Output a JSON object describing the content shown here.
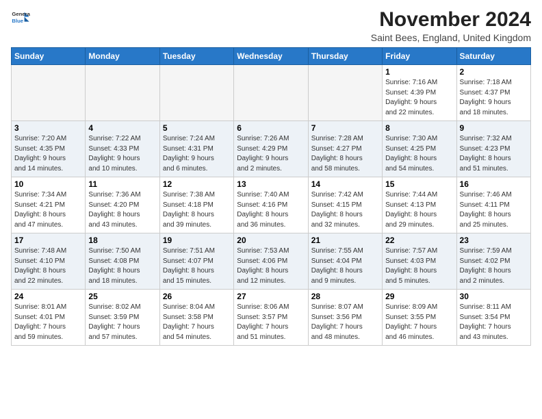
{
  "header": {
    "logo_line1": "General",
    "logo_line2": "Blue",
    "month": "November 2024",
    "location": "Saint Bees, England, United Kingdom"
  },
  "weekdays": [
    "Sunday",
    "Monday",
    "Tuesday",
    "Wednesday",
    "Thursday",
    "Friday",
    "Saturday"
  ],
  "weeks": [
    [
      {
        "day": "",
        "info": ""
      },
      {
        "day": "",
        "info": ""
      },
      {
        "day": "",
        "info": ""
      },
      {
        "day": "",
        "info": ""
      },
      {
        "day": "",
        "info": ""
      },
      {
        "day": "1",
        "info": "Sunrise: 7:16 AM\nSunset: 4:39 PM\nDaylight: 9 hours\nand 22 minutes."
      },
      {
        "day": "2",
        "info": "Sunrise: 7:18 AM\nSunset: 4:37 PM\nDaylight: 9 hours\nand 18 minutes."
      }
    ],
    [
      {
        "day": "3",
        "info": "Sunrise: 7:20 AM\nSunset: 4:35 PM\nDaylight: 9 hours\nand 14 minutes."
      },
      {
        "day": "4",
        "info": "Sunrise: 7:22 AM\nSunset: 4:33 PM\nDaylight: 9 hours\nand 10 minutes."
      },
      {
        "day": "5",
        "info": "Sunrise: 7:24 AM\nSunset: 4:31 PM\nDaylight: 9 hours\nand 6 minutes."
      },
      {
        "day": "6",
        "info": "Sunrise: 7:26 AM\nSunset: 4:29 PM\nDaylight: 9 hours\nand 2 minutes."
      },
      {
        "day": "7",
        "info": "Sunrise: 7:28 AM\nSunset: 4:27 PM\nDaylight: 8 hours\nand 58 minutes."
      },
      {
        "day": "8",
        "info": "Sunrise: 7:30 AM\nSunset: 4:25 PM\nDaylight: 8 hours\nand 54 minutes."
      },
      {
        "day": "9",
        "info": "Sunrise: 7:32 AM\nSunset: 4:23 PM\nDaylight: 8 hours\nand 51 minutes."
      }
    ],
    [
      {
        "day": "10",
        "info": "Sunrise: 7:34 AM\nSunset: 4:21 PM\nDaylight: 8 hours\nand 47 minutes."
      },
      {
        "day": "11",
        "info": "Sunrise: 7:36 AM\nSunset: 4:20 PM\nDaylight: 8 hours\nand 43 minutes."
      },
      {
        "day": "12",
        "info": "Sunrise: 7:38 AM\nSunset: 4:18 PM\nDaylight: 8 hours\nand 39 minutes."
      },
      {
        "day": "13",
        "info": "Sunrise: 7:40 AM\nSunset: 4:16 PM\nDaylight: 8 hours\nand 36 minutes."
      },
      {
        "day": "14",
        "info": "Sunrise: 7:42 AM\nSunset: 4:15 PM\nDaylight: 8 hours\nand 32 minutes."
      },
      {
        "day": "15",
        "info": "Sunrise: 7:44 AM\nSunset: 4:13 PM\nDaylight: 8 hours\nand 29 minutes."
      },
      {
        "day": "16",
        "info": "Sunrise: 7:46 AM\nSunset: 4:11 PM\nDaylight: 8 hours\nand 25 minutes."
      }
    ],
    [
      {
        "day": "17",
        "info": "Sunrise: 7:48 AM\nSunset: 4:10 PM\nDaylight: 8 hours\nand 22 minutes."
      },
      {
        "day": "18",
        "info": "Sunrise: 7:50 AM\nSunset: 4:08 PM\nDaylight: 8 hours\nand 18 minutes."
      },
      {
        "day": "19",
        "info": "Sunrise: 7:51 AM\nSunset: 4:07 PM\nDaylight: 8 hours\nand 15 minutes."
      },
      {
        "day": "20",
        "info": "Sunrise: 7:53 AM\nSunset: 4:06 PM\nDaylight: 8 hours\nand 12 minutes."
      },
      {
        "day": "21",
        "info": "Sunrise: 7:55 AM\nSunset: 4:04 PM\nDaylight: 8 hours\nand 9 minutes."
      },
      {
        "day": "22",
        "info": "Sunrise: 7:57 AM\nSunset: 4:03 PM\nDaylight: 8 hours\nand 5 minutes."
      },
      {
        "day": "23",
        "info": "Sunrise: 7:59 AM\nSunset: 4:02 PM\nDaylight: 8 hours\nand 2 minutes."
      }
    ],
    [
      {
        "day": "24",
        "info": "Sunrise: 8:01 AM\nSunset: 4:01 PM\nDaylight: 7 hours\nand 59 minutes."
      },
      {
        "day": "25",
        "info": "Sunrise: 8:02 AM\nSunset: 3:59 PM\nDaylight: 7 hours\nand 57 minutes."
      },
      {
        "day": "26",
        "info": "Sunrise: 8:04 AM\nSunset: 3:58 PM\nDaylight: 7 hours\nand 54 minutes."
      },
      {
        "day": "27",
        "info": "Sunrise: 8:06 AM\nSunset: 3:57 PM\nDaylight: 7 hours\nand 51 minutes."
      },
      {
        "day": "28",
        "info": "Sunrise: 8:07 AM\nSunset: 3:56 PM\nDaylight: 7 hours\nand 48 minutes."
      },
      {
        "day": "29",
        "info": "Sunrise: 8:09 AM\nSunset: 3:55 PM\nDaylight: 7 hours\nand 46 minutes."
      },
      {
        "day": "30",
        "info": "Sunrise: 8:11 AM\nSunset: 3:54 PM\nDaylight: 7 hours\nand 43 minutes."
      }
    ]
  ]
}
